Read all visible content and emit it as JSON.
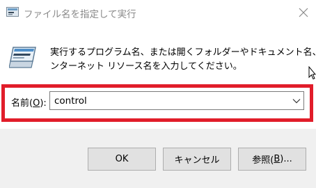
{
  "window": {
    "title": "ファイル名を指定して実行",
    "close_icon": "close-icon",
    "app_icon": "run-icon"
  },
  "description": {
    "line1": "実行するプログラム名、または開くフォルダーやドキュメント名、イ",
    "line2": "ンターネット リソース名を入力してください。"
  },
  "open_field": {
    "label_before": "名前(",
    "label_accel": "O",
    "label_after": "):",
    "value": "control",
    "dropdown_icon": "chevron-down-icon"
  },
  "buttons": {
    "ok": "OK",
    "cancel": "キャンセル",
    "browse_before": "参照(",
    "browse_accel": "B",
    "browse_after": ")..."
  },
  "colors": {
    "highlight": "#e11d2a",
    "footer_bg": "#f0f0f0",
    "button_bg": "#e1e1e1"
  }
}
